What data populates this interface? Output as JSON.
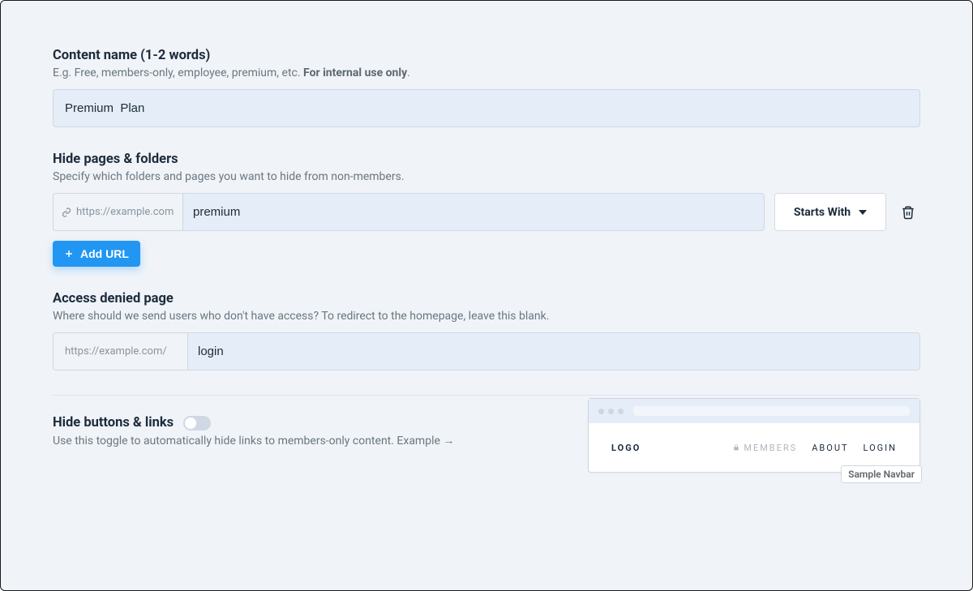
{
  "content_name": {
    "title": "Content name  (1-2 words)",
    "help_prefix": "E.g. Free, members-only, employee, premium, etc. ",
    "help_bold": "For internal use only",
    "value": "Premium  Plan"
  },
  "hide_pages": {
    "title": "Hide pages & folders",
    "help": "Specify which folders and pages you want to hide from non-members.",
    "prefix": "https://example.com",
    "rows": [
      {
        "value": "premium",
        "match": "Starts With"
      }
    ],
    "add_label": "Add URL"
  },
  "access_denied": {
    "title": "Access denied page",
    "help": "Where should we send users who don't have access? To redirect to the homepage, leave this blank.",
    "prefix": "https://example.com/",
    "value": "login"
  },
  "hide_buttons": {
    "title": "Hide buttons & links",
    "help": "Use this toggle to automatically hide links to members-only content. Example →",
    "enabled": false
  },
  "sample": {
    "logo": "LOGO",
    "members": "MEMBERS",
    "about": "ABOUT",
    "login": "LOGIN",
    "label": "Sample Navbar"
  }
}
